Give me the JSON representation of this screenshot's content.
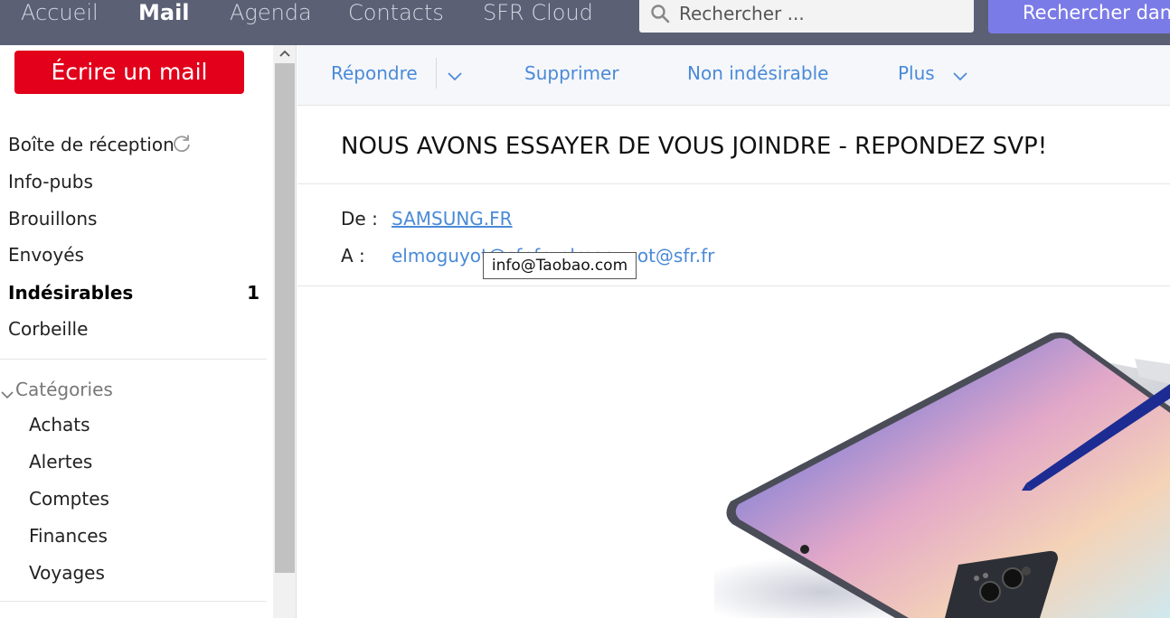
{
  "nav": {
    "items": [
      "Accueil",
      "Mail",
      "Agenda",
      "Contacts",
      "SFR Cloud"
    ],
    "active": "Mail",
    "search_placeholder": "Rechercher ...",
    "search_button": "Rechercher dans m"
  },
  "sidebar": {
    "compose": "Écrire un mail",
    "folders": [
      {
        "label": "Boîte de réception"
      },
      {
        "label": "Info-pubs"
      },
      {
        "label": "Brouillons"
      },
      {
        "label": "Envoyés"
      },
      {
        "label": "Indésirables",
        "count": "1"
      },
      {
        "label": "Corbeille"
      }
    ],
    "categories_label": "Catégories",
    "categories": [
      "Achats",
      "Alertes",
      "Comptes",
      "Finances",
      "Voyages"
    ]
  },
  "toolbar": {
    "reply": "Répondre",
    "delete": "Supprimer",
    "not_spam": "Non indésirable",
    "more": "Plus"
  },
  "message": {
    "subject": "NOUS AVONS ESSAYER DE VOUS JOINDRE - REPONDEZ SVP!",
    "from_label": "De :",
    "from": "SAMSUNG.FR",
    "to_label": "A :",
    "to": "elmoguyot@sfr.fr, elmoguyot@sfr.fr",
    "tooltip": "info@Taobao.com"
  },
  "colors": {
    "topbar": "#5b6075",
    "compose": "#e2001a",
    "link": "#4a8ad8",
    "search_button": "#7b7be8"
  }
}
